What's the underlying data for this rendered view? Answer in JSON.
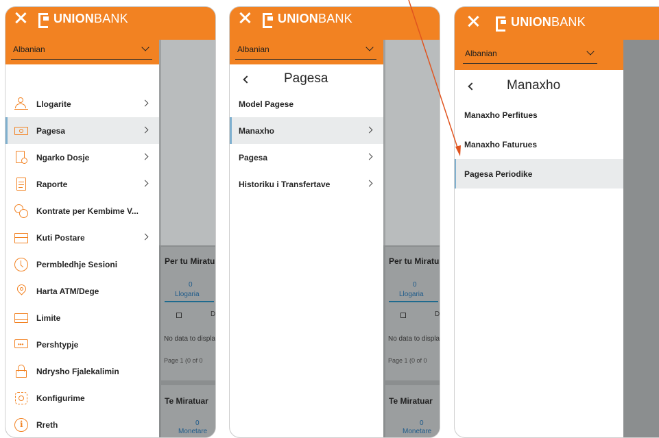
{
  "app": {
    "brand_bold": "UNION",
    "brand_light": "BANK",
    "language": "Albanian"
  },
  "background": {
    "panel1_title": "Per tu Miratu",
    "panel1_tab_count": "0",
    "panel1_tab_label": "Llogaria",
    "panel1_col": "D",
    "panel1_empty": "No data to display",
    "panel1_page": "Page  1  (0 of 0",
    "panel2_title": "Te Miratuar",
    "panel2_tab_count": "0",
    "panel2_tab_label": "Monetare"
  },
  "main_menu": {
    "items": [
      {
        "label": "Llogarite",
        "icon": "users-icon",
        "has_arrow": true,
        "active": false
      },
      {
        "label": "Pagesa",
        "icon": "cash-icon",
        "has_arrow": true,
        "active": true
      },
      {
        "label": "Ngarko Dosje",
        "icon": "file-upload-icon",
        "has_arrow": true,
        "active": false
      },
      {
        "label": "Raporte",
        "icon": "report-icon",
        "has_arrow": true,
        "active": false
      },
      {
        "label": "Kontrate per Kembime V...",
        "icon": "exchange-icon",
        "has_arrow": false,
        "active": false
      },
      {
        "label": "Kuti Postare",
        "icon": "mailbox-icon",
        "has_arrow": true,
        "active": false
      },
      {
        "label": "Permbledhje Sesioni",
        "icon": "clock-icon",
        "has_arrow": false,
        "active": false
      },
      {
        "label": "Harta ATM/Dege",
        "icon": "location-pin-icon",
        "has_arrow": false,
        "active": false
      },
      {
        "label": "Limite",
        "icon": "card-icon",
        "has_arrow": false,
        "active": false
      },
      {
        "label": "Pershtypje",
        "icon": "feedback-icon",
        "has_arrow": false,
        "active": false
      },
      {
        "label": "Ndrysho Fjalekalimin",
        "icon": "lock-icon",
        "has_arrow": false,
        "active": false
      },
      {
        "label": "Konfigurime",
        "icon": "gear-icon",
        "has_arrow": false,
        "active": false
      },
      {
        "label": "Rreth",
        "icon": "info-icon",
        "has_arrow": false,
        "active": false
      }
    ]
  },
  "pagesa_menu": {
    "title": "Pagesa",
    "items": [
      {
        "label": "Model Pagese",
        "has_arrow": false,
        "active": false
      },
      {
        "label": "Manaxho",
        "has_arrow": true,
        "active": true
      },
      {
        "label": "Pagesa",
        "has_arrow": true,
        "active": false
      },
      {
        "label": "Historiku i Transfertave",
        "has_arrow": true,
        "active": false
      }
    ]
  },
  "manaxho_menu": {
    "title": "Manaxho",
    "items": [
      {
        "label": "Manaxho Perfitues",
        "active": false
      },
      {
        "label": "Manaxho Faturues",
        "active": false
      },
      {
        "label": "Pagesa Periodike",
        "active": true
      }
    ]
  },
  "colors": {
    "brand_orange": "#f28222",
    "annotation_arrow": "#e0541f",
    "active_bg": "#e9ebec"
  }
}
